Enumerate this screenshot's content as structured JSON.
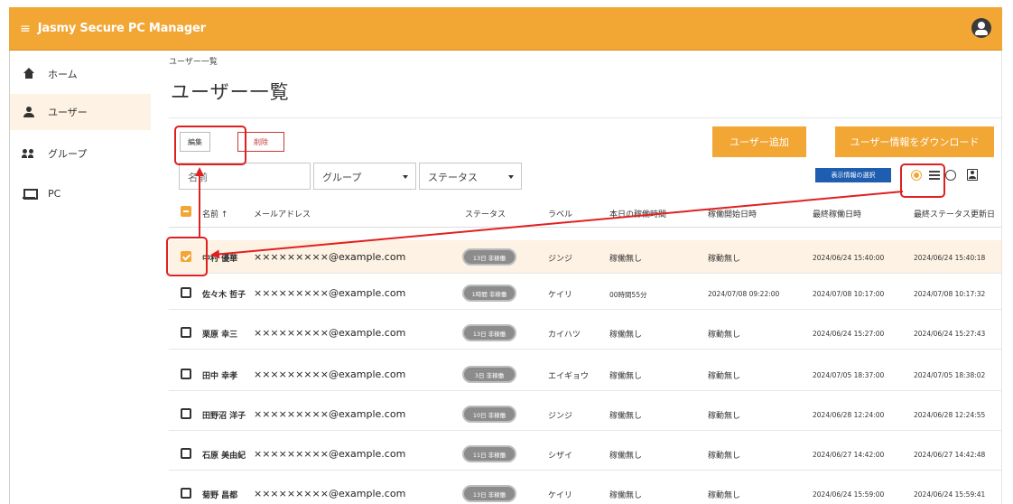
{
  "app": {
    "title": "Jasmy Secure PC Manager",
    "menu_glyph": "≡"
  },
  "sidebar": {
    "items": [
      {
        "label": "ホーム",
        "icon": "home-icon"
      },
      {
        "label": "ユーザー",
        "icon": "user-icon"
      },
      {
        "label": "グループ",
        "icon": "group-icon"
      },
      {
        "label": "PC",
        "icon": "pc-icon"
      }
    ]
  },
  "breadcrumb": "ユーザー一覧",
  "page_title": "ユーザー一覧",
  "toolbar": {
    "edit_label": "編集",
    "delete_label": "削除",
    "add_user_label": "ユーザー追加",
    "download_label": "ユーザー情報をダウンロード",
    "columns_label": "表示情報の選択"
  },
  "filters": {
    "name_placeholder": "名前",
    "group_label": "グループ",
    "status_label": "ステータス"
  },
  "table": {
    "headers": [
      "名前 ↑",
      "メールアドレス",
      "ステータス",
      "ラベル",
      "本日の稼働時間",
      "稼働開始日時",
      "最終稼働日時",
      "最終ステータス更新日"
    ],
    "rows": [
      {
        "name": "中村 優華",
        "email": "×××××××××@example.com",
        "status": "13日 非稼働",
        "label": "ジンジ",
        "uptime": "稼働無し",
        "start": "稼動無し",
        "last": "2024/06/24 15:40:00",
        "updated": "2024/06/24 15:40:18",
        "checked": true
      },
      {
        "name": "佐々木 哲子",
        "email": "×××××××××@example.com",
        "status": "1時間 非稼働",
        "label": "ケイリ",
        "uptime": "00時間55分",
        "start": "2024/07/08 09:22:00",
        "last": "2024/07/08 10:17:00",
        "updated": "2024/07/08 10:17:32",
        "checked": false
      },
      {
        "name": "栗原 幸三",
        "email": "×××××××××@example.com",
        "status": "13日 非稼働",
        "label": "カイハツ",
        "uptime": "稼働無し",
        "start": "稼動無し",
        "last": "2024/06/24 15:27:00",
        "updated": "2024/06/24 15:27:43",
        "checked": false
      },
      {
        "name": "田中 幸孝",
        "email": "×××××××××@example.com",
        "status": "3日 非稼働",
        "label": "エイギョウ",
        "uptime": "稼働無し",
        "start": "稼動無し",
        "last": "2024/07/05 18:37:00",
        "updated": "2024/07/05 18:38:02",
        "checked": false
      },
      {
        "name": "田野沼 洋子",
        "email": "×××××××××@example.com",
        "status": "10日 非稼働",
        "label": "ジンジ",
        "uptime": "稼働無し",
        "start": "稼動無し",
        "last": "2024/06/28 12:24:00",
        "updated": "2024/06/28 12:24:55",
        "checked": false
      },
      {
        "name": "石原 美由紀",
        "email": "×××××××××@example.com",
        "status": "11日 非稼働",
        "label": "シザイ",
        "uptime": "稼働無し",
        "start": "稼動無し",
        "last": "2024/06/27 14:42:00",
        "updated": "2024/06/27 14:42:48",
        "checked": false
      },
      {
        "name": "菊野 昌都",
        "email": "×××××××××@example.com",
        "status": "13日 非稼働",
        "label": "ケイリ",
        "uptime": "稼働無し",
        "start": "稼動無し",
        "last": "2024/06/24 15:59:00",
        "updated": "2024/06/24 15:59:41",
        "checked": false
      }
    ]
  },
  "colors": {
    "accent": "#f2a634",
    "highlight": "#e02020",
    "selected_row": "#fdf2e4",
    "columns_button": "#1f5db0",
    "delete": "#c43a3a"
  }
}
